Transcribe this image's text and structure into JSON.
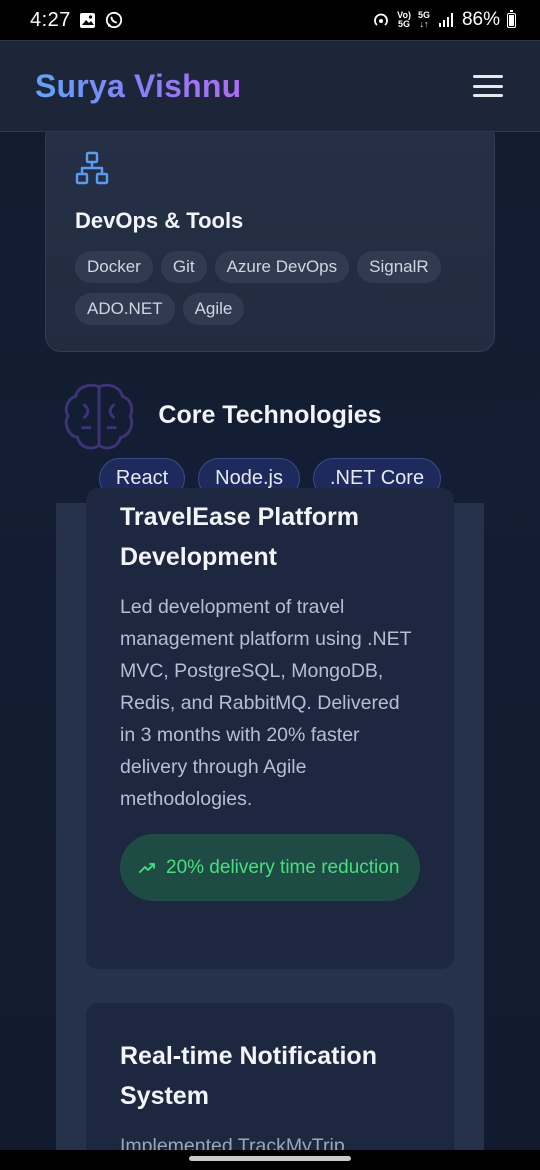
{
  "status": {
    "time": "4:27",
    "network_top": "Vo)",
    "network_bottom": "5G",
    "lte_top": "5G",
    "battery": "86%"
  },
  "header": {
    "brand": "Surya Vishnu"
  },
  "skills_card": {
    "title": "DevOps & Tools",
    "icon": "network-icon",
    "tags": [
      "Docker",
      "Git",
      "Azure DevOps",
      "SignalR",
      "ADO.NET",
      "Agile"
    ]
  },
  "core": {
    "title": "Core Technologies",
    "pills": [
      "React",
      "Node.js",
      ".NET Core"
    ]
  },
  "projects": [
    {
      "title": "TravelEase Platform Development",
      "description": "Led development of travel management platform using .NET MVC, PostgreSQL, MongoDB, Redis, and RabbitMQ. Delivered in 3 months with 20% faster delivery through Agile methodologies.",
      "achievement": "20% delivery time reduction"
    },
    {
      "title": "Real-time Notification System",
      "description": "Implemented TrackMyTrip"
    }
  ],
  "colors": {
    "brand_gradient_start": "#60a5fa",
    "brand_gradient_end": "#b06cf3",
    "achievement_text": "#4ade80",
    "skill_icon": "#5b9bf0"
  }
}
